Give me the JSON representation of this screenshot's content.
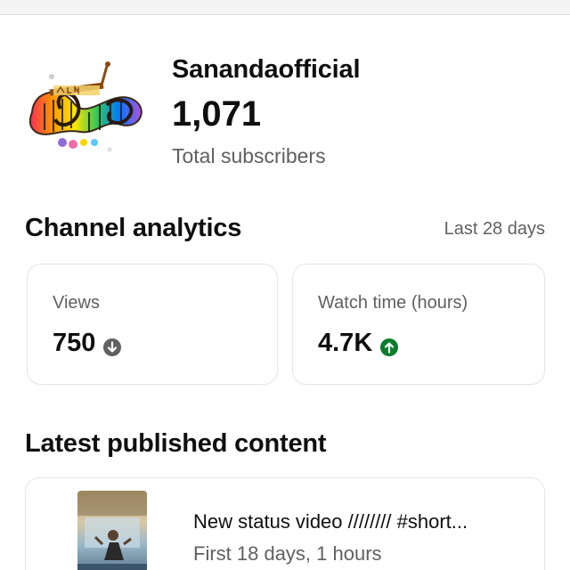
{
  "channel": {
    "name": "Sanandaofficial",
    "subscriber_count": "1,071",
    "subscriber_label": "Total subscribers",
    "logo": "sananda-rainbow-piano-logo"
  },
  "analytics": {
    "title": "Channel analytics",
    "range": "Last 28 days",
    "cards": [
      {
        "label": "Views",
        "value": "750",
        "trend": "down",
        "trend_icon": "arrow-down-circle-icon",
        "trend_color": "#606060"
      },
      {
        "label": "Watch time (hours)",
        "value": "4.7K",
        "trend": "up",
        "trend_icon": "arrow-up-circle-icon",
        "trend_color": "#0b7d2d"
      }
    ]
  },
  "latest": {
    "title": "Latest published content",
    "items": [
      {
        "title": "New status video //////// #short...",
        "meta": "First 18 days, 1 hours",
        "thumbnail": "video-thumbnail"
      }
    ]
  },
  "colors": {
    "text_primary": "#0f0f0f",
    "text_secondary": "#606060",
    "card_border": "#e6e6e6",
    "trend_up": "#0b7d2d"
  }
}
